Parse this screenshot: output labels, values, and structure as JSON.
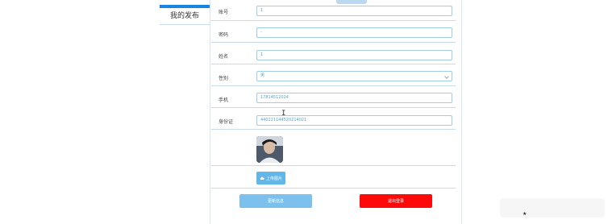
{
  "sidebar": {
    "items": [
      {
        "label": "我的发布"
      }
    ]
  },
  "form": {
    "fields": [
      {
        "label": "账号",
        "value": "1"
      },
      {
        "label": "密码",
        "value": "-"
      },
      {
        "label": "姓名",
        "value": "1"
      },
      {
        "label": "性别",
        "value": "男"
      },
      {
        "label": "手机",
        "value": "17814512024"
      },
      {
        "label": "身份证",
        "value": "440121144520214021"
      }
    ],
    "upload_label": "上传图片",
    "update_label": "更新信息",
    "logout_label": "退出登录"
  },
  "colors": {
    "accent": "#1a84e6",
    "primary_button": "#7cc1ee",
    "danger_button": "#ff0a0a",
    "field_border": "#9fcde5"
  },
  "icons": [
    "upload-cloud-icon",
    "chevron-down-icon",
    "text-cursor-icon",
    "star-icon"
  ]
}
